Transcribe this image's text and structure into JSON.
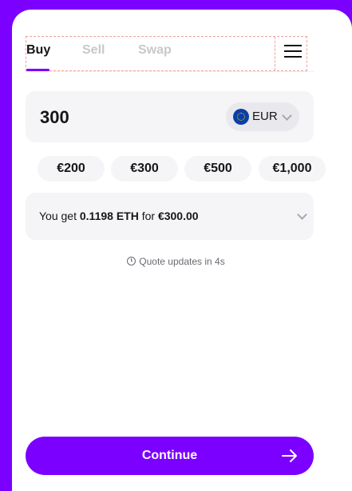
{
  "tabs": [
    {
      "label": "Buy",
      "active": true
    },
    {
      "label": "Sell",
      "active": false
    },
    {
      "label": "Swap",
      "active": false
    }
  ],
  "menu_icon": "hamburger-menu-icon",
  "amount": {
    "value": "300",
    "currency": "EUR",
    "currency_icon": "eu-flag-icon"
  },
  "presets": [
    "€200",
    "€300",
    "€500",
    "€1,000"
  ],
  "quote": {
    "prefix": "You get",
    "crypto_amount": "0.1198 ETH",
    "middle": "for",
    "fiat_amount": "€300.00"
  },
  "quote_note": "Quote updates in 4s",
  "continue": {
    "label": "Continue",
    "icon": "arrow-right-icon"
  },
  "colors": {
    "accent": "#7b00ff",
    "text": "#161616",
    "muted": "#c8c8cc",
    "surface": "#f5f5f7"
  }
}
